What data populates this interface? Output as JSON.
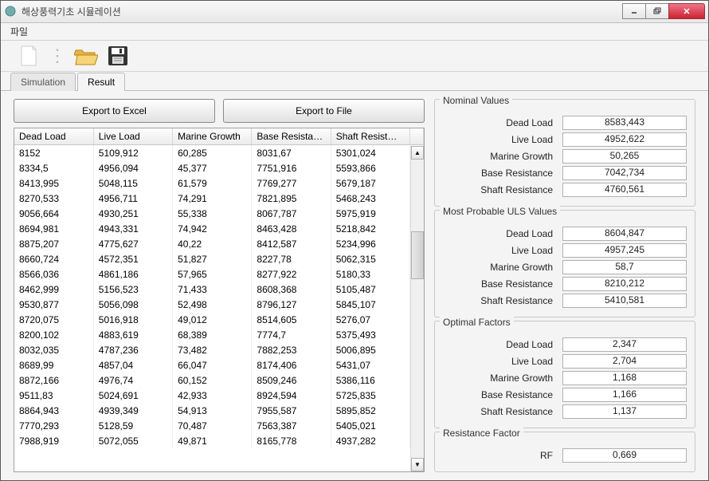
{
  "window": {
    "title": "해상풍력기초 시뮬레이션"
  },
  "menu": {
    "file": "파일"
  },
  "tabs": {
    "simulation": "Simulation",
    "result": "Result"
  },
  "buttons": {
    "export_excel": "Export to Excel",
    "export_file": "Export to File"
  },
  "table": {
    "headers": [
      "Dead Load",
      "Live Load",
      "Marine Growth",
      "Base Resista…",
      "Shaft Resist…"
    ],
    "rows": [
      [
        "8152",
        "5109,912",
        "60,285",
        "8031,67",
        "5301,024"
      ],
      [
        "8334,5",
        "4956,094",
        "45,377",
        "7751,916",
        "5593,866"
      ],
      [
        "8413,995",
        "5048,115",
        "61,579",
        "7769,277",
        "5679,187"
      ],
      [
        "8270,533",
        "4956,711",
        "74,291",
        "7821,895",
        "5468,243"
      ],
      [
        "9056,664",
        "4930,251",
        "55,338",
        "8067,787",
        "5975,919"
      ],
      [
        "8694,981",
        "4943,331",
        "74,942",
        "8463,428",
        "5218,842"
      ],
      [
        "8875,207",
        "4775,627",
        "40,22",
        "8412,587",
        "5234,996"
      ],
      [
        "8660,724",
        "4572,351",
        "51,827",
        "8227,78",
        "5062,315"
      ],
      [
        "8566,036",
        "4861,186",
        "57,965",
        "8277,922",
        "5180,33"
      ],
      [
        "8462,999",
        "5156,523",
        "71,433",
        "8608,368",
        "5105,487"
      ],
      [
        "9530,877",
        "5056,098",
        "52,498",
        "8796,127",
        "5845,107"
      ],
      [
        "8720,075",
        "5016,918",
        "49,012",
        "8514,605",
        "5276,07"
      ],
      [
        "8200,102",
        "4883,619",
        "68,389",
        "7774,7",
        "5375,493"
      ],
      [
        "8032,035",
        "4787,236",
        "73,482",
        "7882,253",
        "5006,895"
      ],
      [
        "8689,99",
        "4857,04",
        "66,047",
        "8174,406",
        "5431,07"
      ],
      [
        "8872,166",
        "4976,74",
        "60,152",
        "8509,246",
        "5386,116"
      ],
      [
        "9511,83",
        "5024,691",
        "42,933",
        "8924,594",
        "5725,835"
      ],
      [
        "8864,943",
        "4939,349",
        "54,913",
        "7955,587",
        "5895,852"
      ],
      [
        "7770,293",
        "5128,59",
        "70,487",
        "7563,387",
        "5405,021"
      ],
      [
        "7988,919",
        "5072,055",
        "49,871",
        "8165,778",
        "4937,282"
      ]
    ]
  },
  "nominal": {
    "title": "Nominal Values",
    "dead_load_label": "Dead Load",
    "dead_load": "8583,443",
    "live_load_label": "Live Load",
    "live_load": "4952,622",
    "marine_growth_label": "Marine Growth",
    "marine_growth": "50,265",
    "base_resist_label": "Base Resistance",
    "base_resist": "7042,734",
    "shaft_resist_label": "Shaft Resistance",
    "shaft_resist": "4760,561"
  },
  "uls": {
    "title": "Most Probable ULS Values",
    "dead_load_label": "Dead Load",
    "dead_load": "8604,847",
    "live_load_label": "Live Load",
    "live_load": "4957,245",
    "marine_growth_label": "Marine Growth",
    "marine_growth": "58,7",
    "base_resist_label": "Base Resistance",
    "base_resist": "8210,212",
    "shaft_resist_label": "Shaft Resistance",
    "shaft_resist": "5410,581"
  },
  "optimal": {
    "title": "Optimal Factors",
    "dead_load_label": "Dead Load",
    "dead_load": "2,347",
    "live_load_label": "Live Load",
    "live_load": "2,704",
    "marine_growth_label": "Marine Growth",
    "marine_growth": "1,168",
    "base_resist_label": "Base Resistance",
    "base_resist": "1,166",
    "shaft_resist_label": "Shaft Resistance",
    "shaft_resist": "1,137"
  },
  "rf": {
    "title": "Resistance Factor",
    "label": "RF",
    "value": "0,669"
  }
}
